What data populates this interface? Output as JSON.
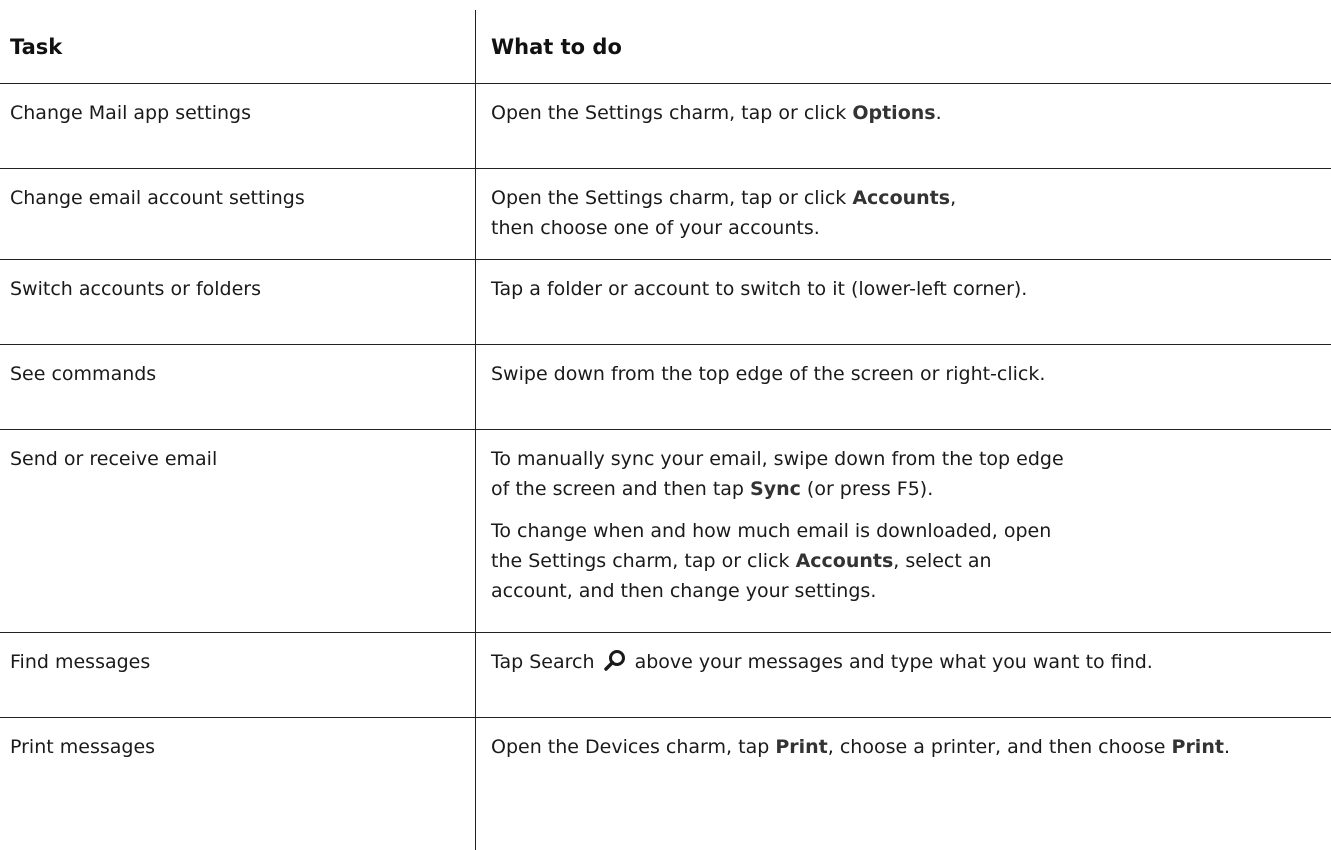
{
  "table": {
    "header": {
      "task": "Task",
      "what": "What to do"
    },
    "rows": [
      {
        "task": "Change Mail app settings",
        "what": [
          {
            "pre": "Open the Settings charm, tap or click ",
            "bold": "Options",
            "post": "."
          }
        ]
      },
      {
        "task": "Change email account settings",
        "what": [
          {
            "pre": "Open the Settings charm, tap or click ",
            "bold": "Accounts",
            "post": ", then choose one of your accounts."
          }
        ]
      },
      {
        "task": "Switch accounts or folders",
        "what": [
          {
            "text": "Tap a folder or account to switch to it (lower-left corner)."
          }
        ]
      },
      {
        "task": "See commands",
        "what": [
          {
            "text": "Swipe down from the top edge of the screen or right-click."
          }
        ]
      },
      {
        "task": "Send or receive email",
        "what": [
          {
            "pre": "To manually sync your email, swipe down from the top edge of the screen and then tap ",
            "bold": "Sync",
            "post": " (or press F5)."
          },
          {
            "pre": "To change when and how much email is downloaded, open the Settings charm, tap or click ",
            "bold": "Accounts",
            "post": ", select an account, and then change your settings."
          }
        ]
      },
      {
        "task": "Find messages",
        "what": [
          {
            "pre": "Tap Search ",
            "icon": "search-icon",
            "post": " above your messages and type what you want to find."
          }
        ]
      },
      {
        "task": "Print messages",
        "what": [
          {
            "pre": "Open the Devices charm, tap ",
            "bold": "Print",
            "mid": ", choose a printer, and then choose ",
            "bold2": "Print",
            "post": "."
          }
        ]
      }
    ]
  }
}
